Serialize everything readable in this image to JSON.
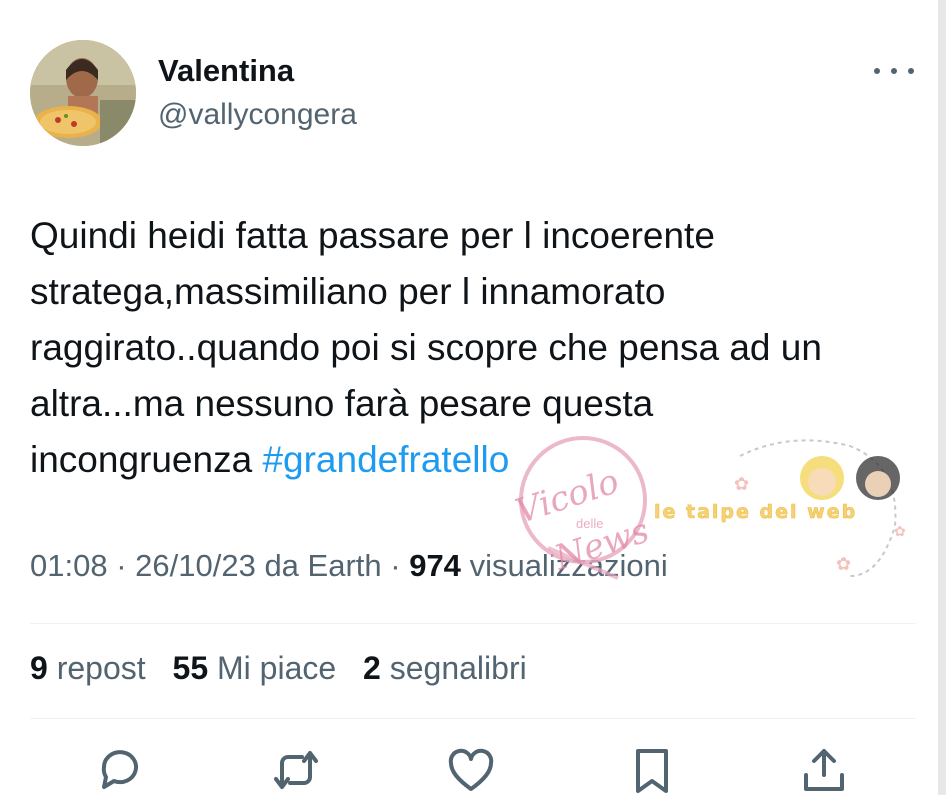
{
  "user": {
    "name": "Valentina",
    "handle": "@vallycongera"
  },
  "tweet": {
    "text": "Quindi heidi fatta passare per l incoerente\nstratega,massimiliano per l innamorato\nraggirato..quando poi si scopre che pensa ad un\naltra...ma nessuno farà pesare questa\nincongruenza ",
    "hashtag": "#grandefratello"
  },
  "meta": {
    "time": "01:08",
    "date": "26/10/23",
    "source": "da Earth",
    "separator": " · ",
    "views_count": "974",
    "views_label": "visualizzazioni"
  },
  "stats": {
    "reposts": {
      "count": "9",
      "label": "repost"
    },
    "likes": {
      "count": "55",
      "label": "Mi piace"
    },
    "bookmarks": {
      "count": "2",
      "label": "segnalibri"
    }
  },
  "watermarks": {
    "left": {
      "line1": "Vicolo",
      "line2": "delle",
      "line3": "News"
    },
    "right": "le talpe del web"
  },
  "colors": {
    "text": "#0f1419",
    "secondary": "#536471",
    "link": "#1d9bf0",
    "divider": "#eff3f4"
  },
  "icons": [
    "more-icon",
    "reply-icon",
    "repost-icon",
    "like-icon",
    "bookmark-icon",
    "share-icon"
  ]
}
